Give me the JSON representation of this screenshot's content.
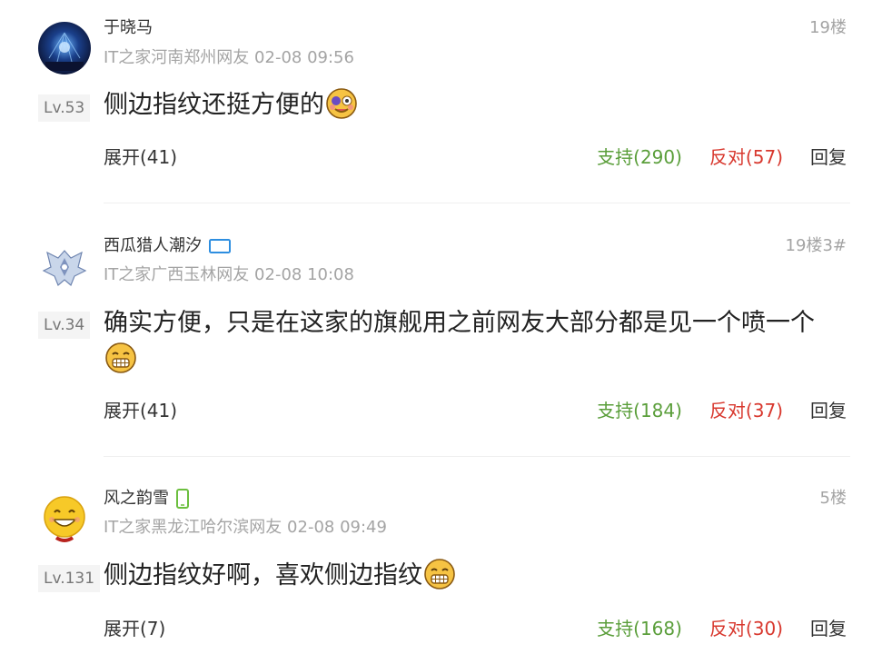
{
  "comments": [
    {
      "username": "于晓马",
      "location": "IT之家河南郑州网友",
      "time": "02-08 09:56",
      "floor": "19楼",
      "level": "Lv.53",
      "content": "侧边指纹还挺方便的",
      "emoji": "dizzy-emoji",
      "expand": "展开(41)",
      "support": "支持(290)",
      "oppose": "反对(57)",
      "reply": "回复",
      "avatar": "concert-stage-avatar",
      "user_icon": ""
    },
    {
      "username": "西瓜猎人潮汐",
      "location": "IT之家广西玉林网友",
      "time": "02-08 10:08",
      "floor": "19楼3#",
      "level": "Lv.34",
      "content": "确实方便，只是在这家的旗舰用之前网友大部分都是见一个喷一个",
      "emoji": "grin-emoji",
      "expand": "展开(41)",
      "support": "支持(184)",
      "oppose": "反对(37)",
      "reply": "回复",
      "avatar": "winged-emblem-avatar",
      "user_icon": "tablet-icon"
    },
    {
      "username": "风之韵雪",
      "location": "IT之家黑龙江哈尔滨网友",
      "time": "02-08 09:49",
      "floor": "5楼",
      "level": "Lv.131",
      "content": "侧边指纹好啊，喜欢侧边指纹",
      "emoji": "grin-emoji",
      "expand": "展开(7)",
      "support": "支持(168)",
      "oppose": "反对(30)",
      "reply": "回复",
      "avatar": "smiley-avatar",
      "user_icon": "phone-icon"
    }
  ],
  "colors": {
    "support": "#5a9e3a",
    "oppose": "#d8382e",
    "meta": "#a4a4a4",
    "device_icon_blue": "#2d8ee0",
    "device_icon_green": "#6cbf3f"
  }
}
